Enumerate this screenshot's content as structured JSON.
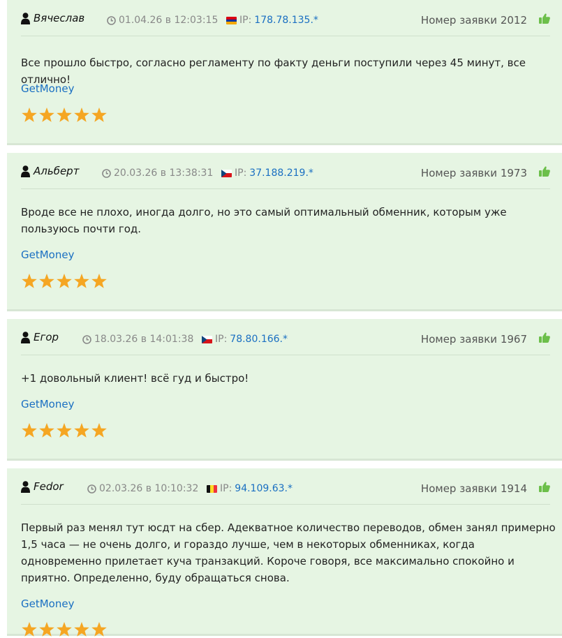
{
  "reviews": [
    {
      "author": "Вячеслав",
      "date": "01.04.26 в 12:03:15",
      "ip_label": "IP:",
      "ip": "178.78.135.*",
      "flag": "armenia-flag",
      "order": "Номер заявки 2012",
      "text": "Все прошло быстро, согласно регламенту по факту деньги поступили через 45 минут, все отлично!",
      "service": "GetMoney",
      "rating": 5
    },
    {
      "author": "Альберт",
      "date": "20.03.26 в 13:38:31",
      "ip_label": "IP:",
      "ip": "37.188.219.*",
      "flag": "czech-flag",
      "order": "Номер заявки 1973",
      "text": "Вроде все не плохо, иногда долго, но это самый оптимальный обменник, которым уже пользуюсь почти год.",
      "service": "GetMoney",
      "rating": 5
    },
    {
      "author": "Егор",
      "date": "18.03.26 в 14:01:38",
      "ip_label": "IP:",
      "ip": "78.80.166.*",
      "flag": "czech-flag",
      "order": "Номер заявки 1967",
      "text": "+1 довольный клиент! всё гуд и быстро!",
      "service": "GetMoney",
      "rating": 5
    },
    {
      "author": "Fedor",
      "date": "02.03.26 в 10:10:32",
      "ip_label": "IP:",
      "ip": "94.109.63.*",
      "flag": "belgium-flag",
      "order": "Номер заявки 1914",
      "text": "Первый раз менял тут юсдт на сбер. Адекватное количество переводов, обмен занял примерно 1,5 часа — не очень долго, и гораздо лучше, чем в некоторых обменниках, когда одновременно прилетает куча транзакций. Короче говоря, все максимально спокойно и приятно. Определенно, буду обращаться снова.",
      "service": "GetMoney",
      "rating": 5
    }
  ],
  "colors": {
    "card_bg": "#e6f5e3",
    "link": "#1a6fc2",
    "star": "#f5a623",
    "thumb": "#6cbf4a"
  }
}
